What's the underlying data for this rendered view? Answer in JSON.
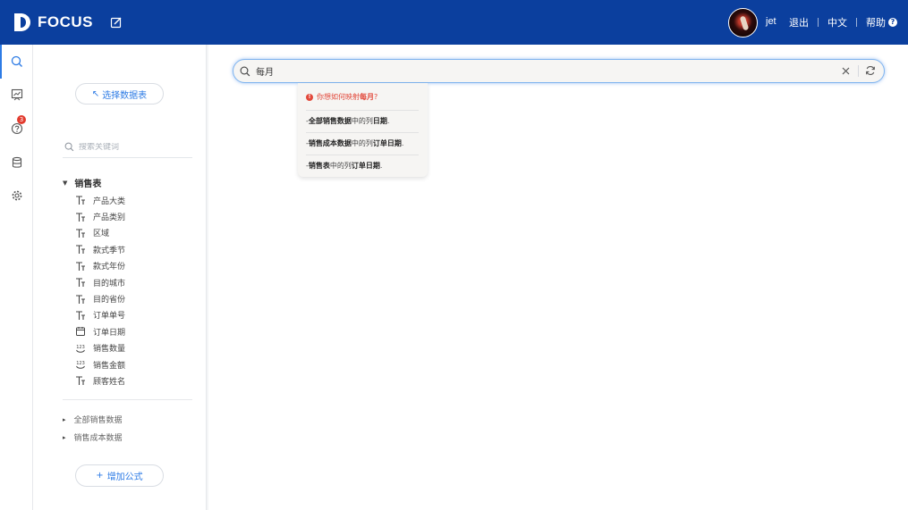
{
  "header": {
    "brand": "FOCUS",
    "username": "jet",
    "logout": "退出",
    "language": "中文",
    "help": "帮助",
    "help_badge": "?",
    "background_color": "#0b3f9e"
  },
  "rail": {
    "items": [
      {
        "icon": "search-icon",
        "active": true
      },
      {
        "icon": "board-icon"
      },
      {
        "icon": "question-icon",
        "badge": "3"
      },
      {
        "icon": "database-icon"
      },
      {
        "icon": "gear-icon"
      }
    ]
  },
  "panel": {
    "select_table_label": "选择数据表",
    "select_table_arrow": "↖",
    "search_placeholder": "搜索关键词",
    "expanded_table": {
      "name": "销售表",
      "caret": "▼",
      "columns": [
        {
          "name": "产品大类",
          "type": "text"
        },
        {
          "name": "产品类别",
          "type": "text"
        },
        {
          "name": "区域",
          "type": "text"
        },
        {
          "name": "款式季节",
          "type": "text"
        },
        {
          "name": "款式年份",
          "type": "text"
        },
        {
          "name": "目的城市",
          "type": "text"
        },
        {
          "name": "目的省份",
          "type": "text"
        },
        {
          "name": "订单单号",
          "type": "text"
        },
        {
          "name": "订单日期",
          "type": "date"
        },
        {
          "name": "销售数量",
          "type": "number"
        },
        {
          "name": "销售金额",
          "type": "number"
        },
        {
          "name": "顾客姓名",
          "type": "text"
        }
      ]
    },
    "other_tables": [
      {
        "name": "全部销售数据",
        "caret": "▸"
      },
      {
        "name": "销售成本数据",
        "caret": "▸"
      }
    ],
    "add_formula_label": "增加公式",
    "add_formula_plus": "+"
  },
  "search": {
    "query": "每月",
    "clear_icon": "close-icon",
    "refresh_icon": "refresh-icon"
  },
  "suggestion": {
    "warning_mark": "!",
    "prompt_prefix": "你想如何映射",
    "prompt_term": "每月",
    "prompt_suffix": "?",
    "items": [
      {
        "dash": "- ",
        "source": "全部销售数据",
        "mid": "中的列",
        "column": "日期",
        "end": "."
      },
      {
        "dash": "- ",
        "source": "销售成本数据",
        "mid": "中的列",
        "column": "订单日期",
        "end": "."
      },
      {
        "dash": "- ",
        "source": "销售表",
        "mid": "中的列",
        "column": "订单日期",
        "end": "."
      }
    ]
  },
  "colors": {
    "accent": "#2d7be5",
    "warning": "#e2483a",
    "badge": "#e23b2e"
  }
}
